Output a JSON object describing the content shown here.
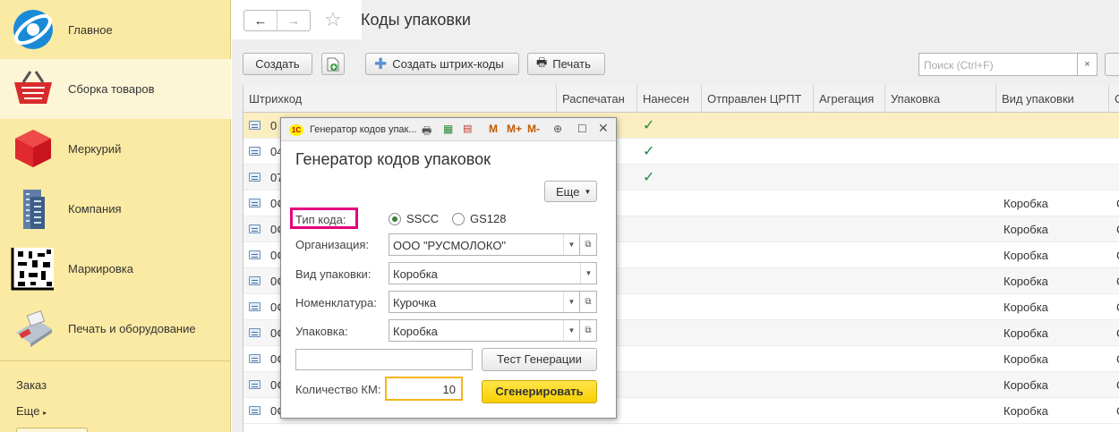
{
  "sidebar": {
    "items": [
      {
        "label": "Главное",
        "icon": "globe-icon"
      },
      {
        "label": "Сборка товаров",
        "icon": "basket-icon"
      },
      {
        "label": "Меркурий",
        "icon": "red-cube-icon"
      },
      {
        "label": "Компания",
        "icon": "building-icon"
      },
      {
        "label": "Маркировка",
        "icon": "datamatrix-icon"
      },
      {
        "label": "Печать и оборудование",
        "icon": "printer-terminal-icon"
      }
    ],
    "links": [
      "Заказ",
      "Еще"
    ]
  },
  "header": {
    "back": "←",
    "forward": "→",
    "title": "Коды упаковки"
  },
  "toolbar": {
    "create": "Создать",
    "create_barcodes": "Создать штрих-коды",
    "print": "Печать",
    "search_placeholder": "Поиск (Ctrl+F)",
    "clear": "×"
  },
  "table": {
    "columns": [
      "Штрихкод",
      "Распечатан",
      "Нанесен",
      "Отправлен ЦРПТ",
      "Агрегация",
      "Упаковка",
      "Вид упаковки",
      "С"
    ],
    "rows": [
      {
        "code": "0",
        "applied": "✓",
        "kind": ""
      },
      {
        "code": "04",
        "applied": "✓",
        "kind": ""
      },
      {
        "code": "07",
        "applied": "✓",
        "kind": ""
      },
      {
        "code": "0¢",
        "applied": "",
        "kind": "Коробка",
        "extra": "С"
      },
      {
        "code": "0¢",
        "applied": "",
        "kind": "Коробка",
        "extra": "С"
      },
      {
        "code": "0¢",
        "applied": "",
        "kind": "Коробка",
        "extra": "С"
      },
      {
        "code": "0¢",
        "applied": "",
        "kind": "Коробка",
        "extra": "С"
      },
      {
        "code": "0¢",
        "applied": "",
        "kind": "Коробка",
        "extra": "С"
      },
      {
        "code": "0¢",
        "applied": "",
        "kind": "Коробка",
        "extra": "С"
      },
      {
        "code": "0¢",
        "applied": "",
        "kind": "Коробка",
        "extra": "С"
      },
      {
        "code": "0¢",
        "applied": "",
        "kind": "Коробка",
        "extra": "С"
      },
      {
        "code": "0¢",
        "applied": "",
        "kind": "Коробка",
        "extra": "С"
      }
    ]
  },
  "dialog": {
    "window_title": "Генератор кодов упак...",
    "heading": "Генератор кодов упаковок",
    "more": "Еще",
    "code_type_label": "Тип кода:",
    "radio_sscc": "SSCC",
    "radio_gs128": "GS128",
    "selected_radio": "SSCC",
    "org_label": "Организация:",
    "org_value": "ООО \"РУСМОЛОКО\"",
    "pack_kind_label": "Вид упаковки:",
    "pack_kind_value": "Коробка",
    "nomenclature_label": "Номенклатура:",
    "nomenclature_value": "Курочка",
    "pack_label": "Упаковка:",
    "pack_value": "Коробка",
    "test_button": "Тест Генерации",
    "qty_label": "Количество КМ:",
    "qty_value": "10",
    "generate_button": "Сгенерировать",
    "tools": [
      "M",
      "M+",
      "M-"
    ]
  },
  "colors": {
    "sidebar_bg": "#fbeaa3",
    "selected_row": "#fbeec1",
    "check_green": "#1e8c46",
    "highlight_magenta": "#e3007e",
    "generate_yellow": "#f7cf00"
  }
}
